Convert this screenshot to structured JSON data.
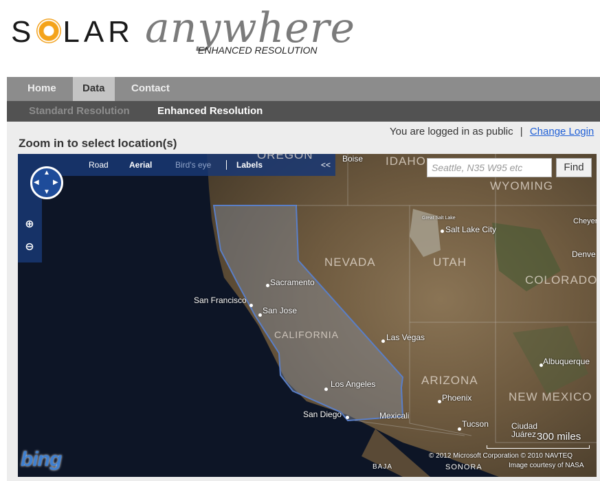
{
  "logo": {
    "solar_before": "S",
    "solar_after": "LAR",
    "anywhere": "anywhere",
    "subtitle": "ENHANCED RESOLUTION"
  },
  "nav": {
    "tabs": [
      "Home",
      "Data",
      "Contact"
    ],
    "active": "Data"
  },
  "subnav": {
    "items": [
      "Standard Resolution",
      "Enhanced Resolution"
    ],
    "active": "Enhanced Resolution"
  },
  "login": {
    "text": "You are logged in as public",
    "separator": "|",
    "link": "Change Login"
  },
  "page": {
    "title": "Zoom in to select location(s)"
  },
  "map_toolbar": {
    "road": "Road",
    "aerial": "Aerial",
    "birds_eye": "Bird's eye",
    "labels": "Labels",
    "collapse": "<<"
  },
  "search": {
    "placeholder": "Seattle, N35 W95 etc",
    "button": "Find"
  },
  "map_labels": {
    "boise": "Boise",
    "idaho": "IDAHO",
    "wyoming": "WYOMING",
    "oregon": "OREGON",
    "salt_lake_city": "Salt Lake City",
    "cheyenne": "Cheyer",
    "denver": "Denve",
    "nevada": "NEVADA",
    "utah": "UTAH",
    "colorado": "COLORADO",
    "sacramento": "Sacramento",
    "san_francisco": "San Francisco",
    "san_jose": "San Jose",
    "california": "CALIFORNIA",
    "las_vegas": "Las Vegas",
    "albuquerque": "Albuquerque",
    "los_angeles": "Los Angeles",
    "arizona": "ARIZONA",
    "new_mexico": "NEW MEXICO",
    "phoenix": "Phoenix",
    "san_diego": "San Diego",
    "mexicali": "Mexicali",
    "tucson": "Tucson",
    "ciudad_juarez": "Ciudad Juárez",
    "great_salt_lake": "Great Salt Lake",
    "baja": "BAJA",
    "sonora": "SONORA"
  },
  "scale": {
    "text": "300 miles"
  },
  "attribution": {
    "line1": "© 2012 Microsoft Corporation   © 2010 NAVTEQ",
    "line2": "Image courtesy of NASA"
  },
  "brand": {
    "bing": "bing"
  },
  "colors": {
    "nav_bg": "#8c8c8c",
    "subnav_bg": "#525252",
    "link": "#1f5fd6",
    "map_toolbar": "#193773",
    "sun": "#f4a31a"
  }
}
